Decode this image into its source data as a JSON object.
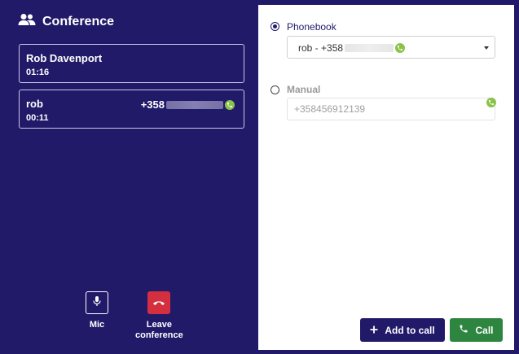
{
  "conference": {
    "title": "Conference",
    "icon": "people-icon"
  },
  "participants": [
    {
      "name": "Rob Davenport",
      "duration": "01:16"
    },
    {
      "name": "rob",
      "duration": "00:11",
      "number_prefix": "+358"
    }
  ],
  "controls": {
    "mic_label": "Mic",
    "leave_label_line1": "Leave",
    "leave_label_line2": "conference"
  },
  "dial": {
    "phonebook_label": "Phonebook",
    "phonebook_selected": "rob - +358",
    "manual_label": "Manual",
    "manual_placeholder": "+358456912139",
    "add_to_call_label": "Add to call",
    "call_label": "Call"
  },
  "colors": {
    "background": "#211a69",
    "leave": "#d32f3e",
    "call": "#2e8540",
    "phone_status": "#8bc34a"
  }
}
